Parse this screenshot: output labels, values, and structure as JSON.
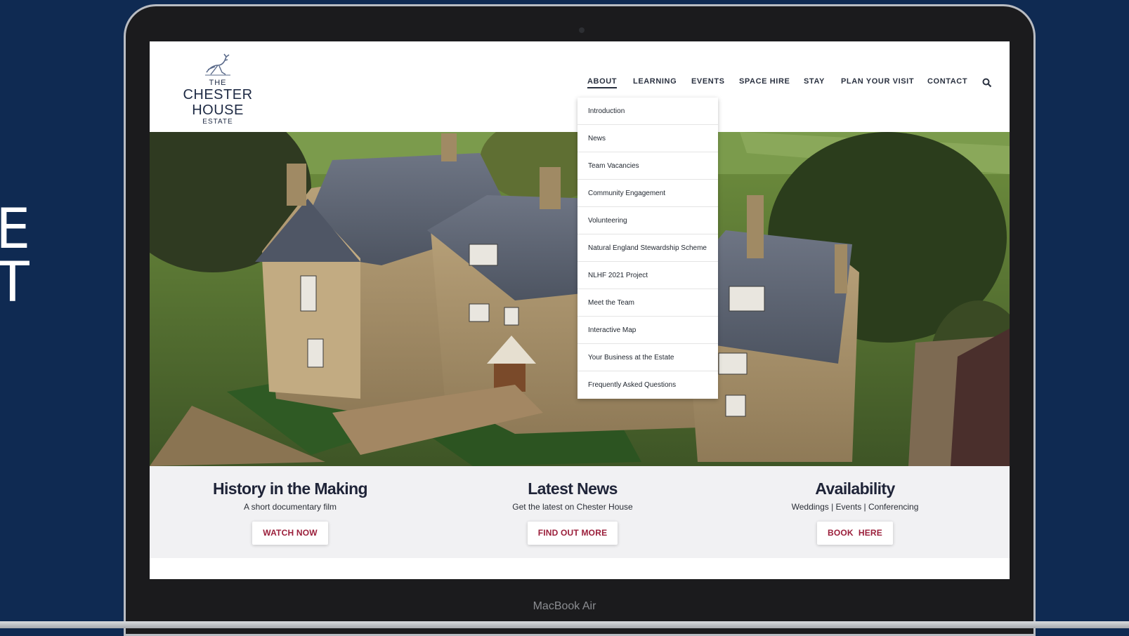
{
  "backdrop": {
    "letters": [
      "E",
      "T"
    ]
  },
  "device": {
    "label": "MacBook Air"
  },
  "logo": {
    "line1": "THE",
    "line2": "CHESTER HOUSE",
    "line3": "ESTATE"
  },
  "nav": {
    "items": [
      {
        "label": "ABOUT",
        "active": true
      },
      {
        "label": "LEARNING"
      },
      {
        "label": "EVENTS"
      },
      {
        "label": "SPACE HIRE"
      },
      {
        "label": "STAY"
      },
      {
        "label": "PLAN YOUR VISIT"
      },
      {
        "label": "CONTACT"
      }
    ],
    "search_icon": "search-icon"
  },
  "dropdown": {
    "items": [
      "Introduction",
      "News",
      "Team Vacancies",
      "Community Engagement",
      "Volunteering",
      "Natural England Stewardship Scheme",
      "NLHF 2021 Project",
      "Meet the Team",
      "Interactive Map",
      "Your Business at the Estate",
      "Frequently Asked Questions"
    ]
  },
  "cta": [
    {
      "title": "History in the Making",
      "subtitle": "A short documentary film",
      "button": "WATCH NOW"
    },
    {
      "title": "Latest News",
      "subtitle": "Get the latest on Chester House",
      "button": "FIND OUT MORE"
    },
    {
      "title": "Availability",
      "subtitle": "Weddings | Events | Conferencing",
      "button": "BOOK  HERE"
    }
  ],
  "colors": {
    "backdrop": "#0f2a52",
    "accent": "#9b1f3b",
    "nav_text": "#2a3140"
  }
}
